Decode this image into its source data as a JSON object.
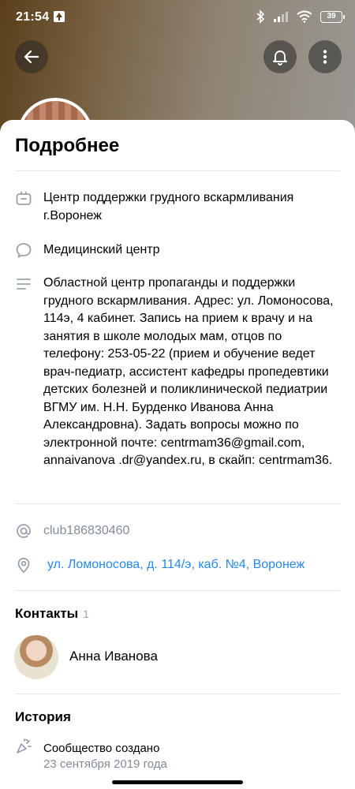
{
  "statusbar": {
    "time": "21:54",
    "battery": "39"
  },
  "header": {
    "back_icon": "arrow-left-icon",
    "bell_icon": "bell-icon",
    "more_icon": "more-vertical-icon"
  },
  "details": {
    "title": "Подробнее",
    "name": "Центр поддержки грудного вскармливания г.Воронеж",
    "category": "Медицинский центр",
    "description": "Областной центр пропаганды и поддержки грудного вскармливания. Адрес: ул. Ломоносова, 114э, 4 кабинет.  Запись на прием к врачу и на занятия в школе молодых мам, отцов по телефону: 253-05-22 (прием и обучение ведет врач-педиатр, ассистент кафедры пропедевтики детских болезней и поликлинической педиатрии ВГМУ им. Н.Н. Бурденко Иванова Анна Александровна). Задать вопросы можно по электронной почте: centrmam36@gmail.com, annaivanova .dr@yandex.ru, в скайп: centrmam36.",
    "screen_name": "club186830460",
    "address": "ул. Ломоносова, д. 114/э, каб. №4, Воронеж"
  },
  "contacts": {
    "title": "Контакты",
    "count": "1",
    "items": [
      {
        "name": "Анна Иванова"
      }
    ]
  },
  "history": {
    "title": "История",
    "event": "Сообщество создано",
    "date": "23 сентября 2019 года"
  },
  "colors": {
    "accent": "#2688eb",
    "muted": "#818c99",
    "icon": "#99a2ad"
  }
}
